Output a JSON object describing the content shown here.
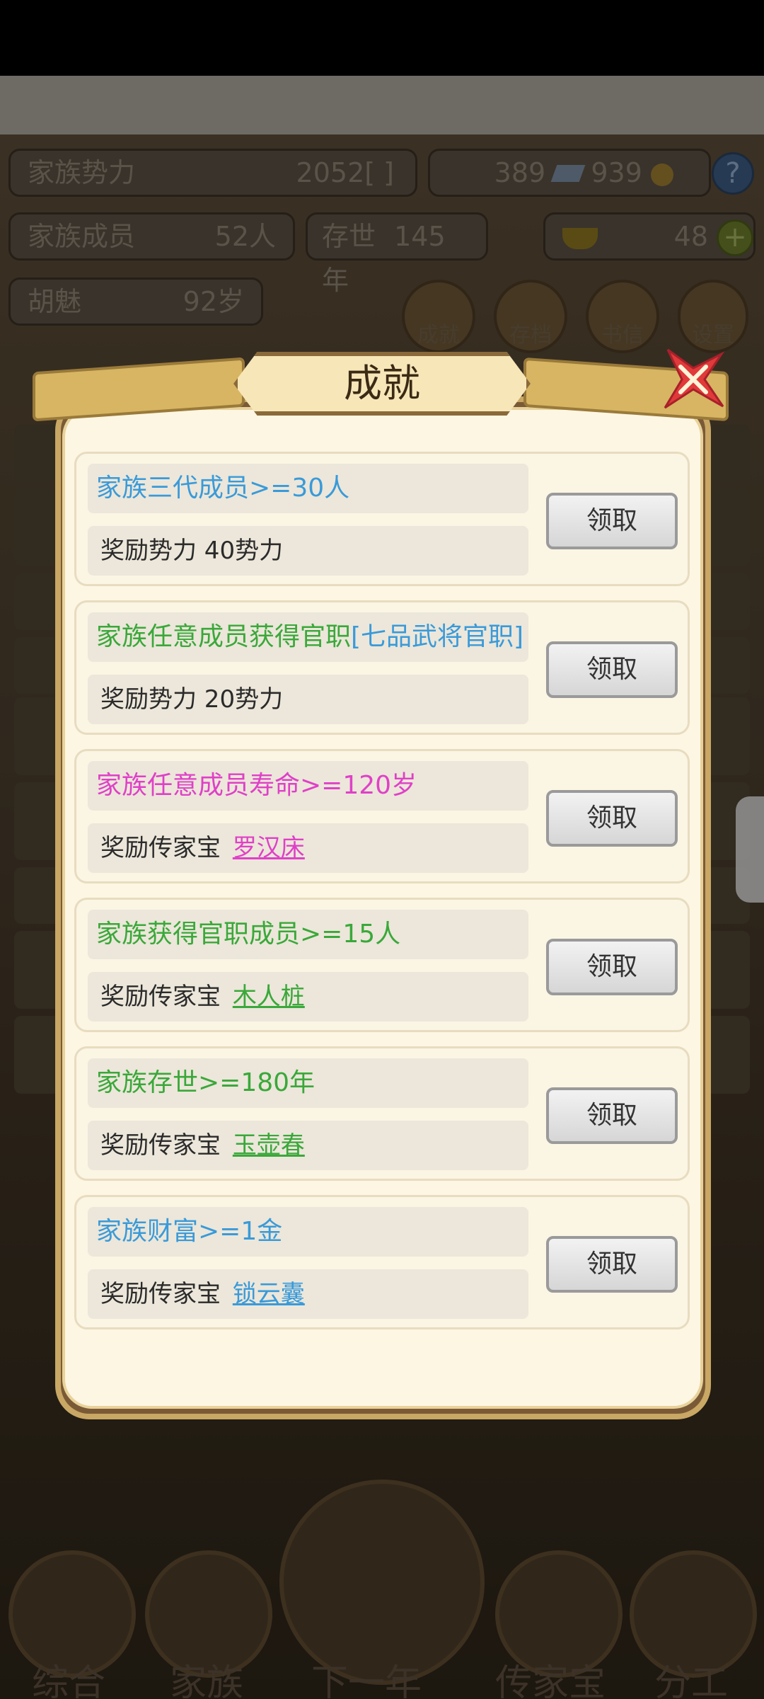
{
  "hud": {
    "power_label": "家族势力",
    "power_value": "2052",
    "power_rank": "[ ]",
    "currency1": "389",
    "currency2": "939",
    "members_label": "家族成员",
    "members_value": "52人",
    "age_label": "存世",
    "age_value": "145年",
    "gold": "48",
    "leader_name": "胡魅",
    "leader_age": "92岁",
    "menu": [
      "成就",
      "存档",
      "书信",
      "设置"
    ]
  },
  "modal": {
    "title": "成就",
    "achievements": [
      {
        "condition": "家族三代成员>=30人",
        "condition_color": "#3a9ad9",
        "reward_prefix": "奖励势力 40势力",
        "reward_item": "",
        "item_color": "",
        "button": "领取"
      },
      {
        "condition": "家族任意成员获得官职",
        "condition_extra": "[七品武将官职]",
        "condition_color": "#3aa83a",
        "extra_color": "#3a9ad9",
        "reward_prefix": "奖励势力 20势力",
        "reward_item": "",
        "item_color": "",
        "button": "领取"
      },
      {
        "condition": "家族任意成员寿命>=120岁",
        "condition_color": "#e040c8",
        "reward_prefix": "奖励传家宝",
        "reward_item": "罗汉床",
        "item_color": "#e040c8",
        "button": "领取"
      },
      {
        "condition": "家族获得官职成员>=15人",
        "condition_color": "#3aa83a",
        "reward_prefix": "奖励传家宝",
        "reward_item": "木人桩",
        "item_color": "#3aa83a",
        "button": "领取"
      },
      {
        "condition": "家族存世>=180年",
        "condition_color": "#3aa83a",
        "reward_prefix": "奖励传家宝",
        "reward_item": "玉壶春",
        "item_color": "#3aa83a",
        "button": "领取"
      },
      {
        "condition": "家族财富>=1金",
        "condition_color": "#3a9ad9",
        "reward_prefix": "奖励传家宝",
        "reward_item": "锁云囊",
        "item_color": "#3a9ad9",
        "button": "领取"
      }
    ]
  },
  "bottom_nav": [
    "综合",
    "家族",
    "下一年",
    "传家宝",
    "分工"
  ]
}
